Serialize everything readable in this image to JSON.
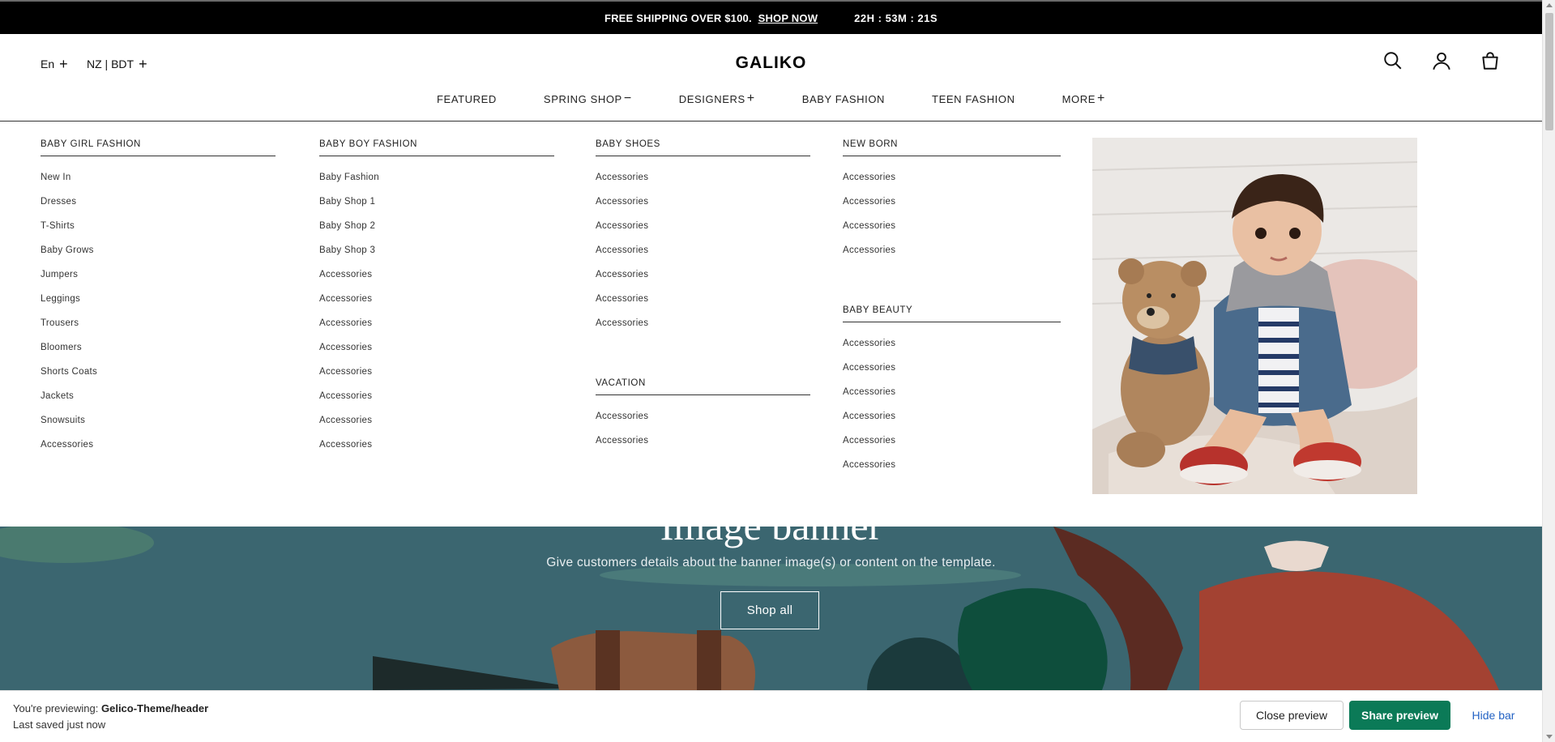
{
  "announcement": {
    "message": "FREE SHIPPING OVER $100.",
    "link_label": "SHOP NOW",
    "countdown": "22H : 53M : 21S"
  },
  "header": {
    "language": "En",
    "currency": "NZ | BDT",
    "logo": "GALIKO",
    "icons": [
      "search-icon",
      "account-icon",
      "cart-icon"
    ]
  },
  "nav": {
    "items": [
      {
        "label": "FEATURED",
        "symbol": ""
      },
      {
        "label": "SPRING SHOP",
        "symbol": "−"
      },
      {
        "label": "DESIGNERS",
        "symbol": "+"
      },
      {
        "label": "BABY FASHION",
        "symbol": ""
      },
      {
        "label": "TEEN FASHION",
        "symbol": ""
      },
      {
        "label": "MORE",
        "symbol": "+"
      }
    ]
  },
  "mega_menu": {
    "baby_girl": {
      "title": "BABY GIRL FASHION",
      "items": [
        "New In",
        "Dresses",
        "T-Shirts",
        "Baby Grows",
        "Jumpers",
        "Leggings",
        "Trousers",
        "Bloomers",
        "Shorts Coats",
        "Jackets",
        "Snowsuits",
        "Accessories"
      ]
    },
    "baby_boy": {
      "title": "BABY BOY FASHION",
      "items": [
        "Baby Fashion",
        "Baby Shop 1",
        "Baby Shop 2",
        "Baby Shop 3",
        "Accessories",
        "Accessories",
        "Accessories",
        "Accessories",
        "Accessories",
        "Accessories",
        "Accessories",
        "Accessories"
      ]
    },
    "baby_shoes": {
      "title": "BABY SHOES",
      "items": [
        "Accessories",
        "Accessories",
        "Accessories",
        "Accessories",
        "Accessories",
        "Accessories",
        "Accessories"
      ]
    },
    "vacation": {
      "title": "VACATION",
      "items": [
        "Accessories",
        "Accessories"
      ]
    },
    "new_born": {
      "title": "NEW BORN",
      "items": [
        "Accessories",
        "Accessories",
        "Accessories",
        "Accessories"
      ]
    },
    "baby_beauty": {
      "title": "BABY BEAUTY",
      "items": [
        "Accessories",
        "Accessories",
        "Accessories",
        "Accessories",
        "Accessories",
        "Accessories"
      ]
    }
  },
  "banner": {
    "heading": "Image banner",
    "text": "Give customers details about the banner image(s) or content on the template.",
    "button": "Shop all",
    "bg_color": "#3b6670"
  },
  "preview_bar": {
    "prefix": "You're previewing:",
    "theme": "Gelico-Theme/header",
    "saved": "Last saved just now",
    "close_label": "Close preview",
    "share_label": "Share preview",
    "hide_label": "Hide bar",
    "accent": "#0b7a57"
  }
}
